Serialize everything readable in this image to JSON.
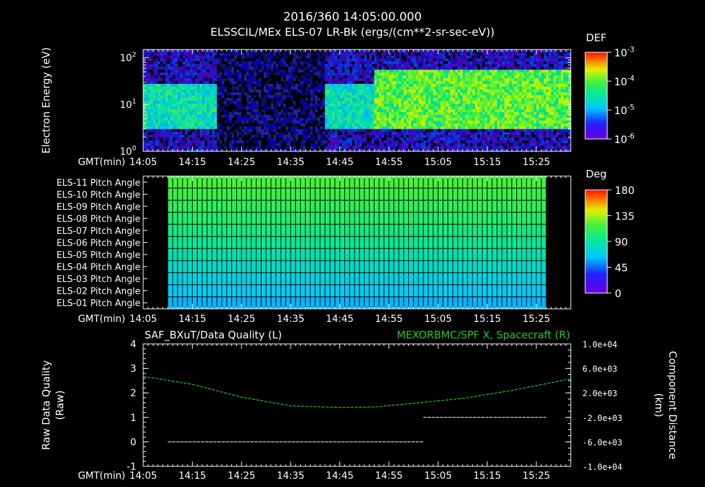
{
  "header": {
    "title": "2016/360 14:05:00.000",
    "subtitle": "ELSSCIL/MEx ELS-07 LR-Bk  (ergs/(cm**2-sr-sec-eV))"
  },
  "time_axis": {
    "label": "GMT(min)",
    "ticks": [
      "14:05",
      "14:15",
      "14:25",
      "14:35",
      "14:45",
      "14:55",
      "15:05",
      "15:15",
      "15:25"
    ]
  },
  "colors": {
    "background": "#000000",
    "foreground": "#ffffff",
    "series_right": "#22cc22",
    "grid_cell": "#000000"
  },
  "chart_data": [
    {
      "type": "heatmap",
      "name_printed": "ELS-07 LR-Bk",
      "ylabel": "Electron Energy (eV)",
      "y_scale": "log",
      "ylim": [
        1,
        150
      ],
      "y_ticks": [
        "10^0",
        "10^1",
        "10^2"
      ],
      "colorbar": {
        "label": "DEF",
        "scale": "log",
        "range": [
          1e-06,
          0.001
        ],
        "ticks": [
          "10^-3",
          "10^-4",
          "10^-5",
          "10^-6"
        ]
      },
      "bands": [
        {
          "from_min": 0,
          "to_min": 15,
          "low_eV": 3,
          "high_eV": 30,
          "level": "cyan-green"
        },
        {
          "from_min": 15,
          "to_min": 37,
          "low_eV": 1,
          "high_eV": 150,
          "level": "sparse-dark-blue"
        },
        {
          "from_min": 37,
          "to_min": 47,
          "low_eV": 3,
          "high_eV": 30,
          "level": "cyan-green"
        },
        {
          "from_min": 47,
          "to_min": 87,
          "low_eV": 3,
          "high_eV": 60,
          "level": "green-yellow"
        }
      ]
    },
    {
      "type": "heatmap",
      "rows": [
        "ELS-11 Pitch Angle",
        "ELS-10 Pitch Angle",
        "ELS-09 Pitch Angle",
        "ELS-08 Pitch Angle",
        "ELS-07 Pitch Angle",
        "ELS-06 Pitch Angle",
        "ELS-05 Pitch Angle",
        "ELS-04 Pitch Angle",
        "ELS-03 Pitch Angle",
        "ELS-02 Pitch Angle",
        "ELS-01 Pitch Angle"
      ],
      "values_deg": [
        118,
        115,
        110,
        104,
        98,
        92,
        86,
        79,
        72,
        66,
        60
      ],
      "data_from_min": 5,
      "data_to_min": 82,
      "colorbar": {
        "label": "Deg",
        "range": [
          0,
          180
        ],
        "ticks": [
          "180",
          "135",
          "90",
          "45",
          "0"
        ]
      }
    },
    {
      "type": "line",
      "title_left": "SAF_BXuT/Data Quality (L)",
      "title_right": "MEXORBMC/SPF X, Spacecraft (R)",
      "ylabel_left": "Raw Data Quality (Raw)",
      "ylabel_right": "Component Distance (km)",
      "ylim_left": [
        -1,
        4
      ],
      "y_ticks_left": [
        "4",
        "3",
        "2",
        "1",
        "0",
        "-1"
      ],
      "ylim_right": [
        -10000,
        10000
      ],
      "y_ticks_right": [
        "1.0e+04",
        "6.0e+03",
        "2.0e+03",
        "-2.0e+03",
        "-6.0e+03",
        "-1.0e+04"
      ],
      "series": [
        {
          "name": "SAF_BXuT/Data Quality",
          "axis": "left",
          "segments": [
            {
              "x_min": [
                5,
                57
              ],
              "y": [
                0,
                0
              ]
            },
            {
              "x_min": [
                57,
                82
              ],
              "y": [
                1,
                1
              ]
            }
          ]
        },
        {
          "name": "MEXORBMC/SPF X, Spacecraft",
          "axis": "right",
          "x_min": [
            0,
            10,
            20,
            30,
            40,
            47,
            55,
            65,
            75,
            87
          ],
          "y": [
            4700,
            3400,
            1300,
            -100,
            -400,
            -300,
            300,
            1100,
            2400,
            4300
          ]
        }
      ]
    }
  ]
}
